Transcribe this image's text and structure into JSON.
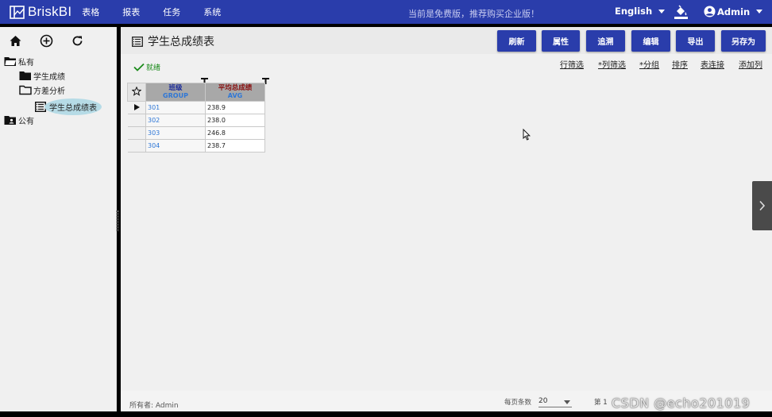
{
  "app": {
    "name": "BriskBI",
    "menu": [
      "表格",
      "报表",
      "任务",
      "系统"
    ],
    "notice": "当前是免费版，推荐购买企业版！",
    "language": "English",
    "user": "Admin"
  },
  "sidebar": {
    "tree": [
      {
        "label": "私有",
        "icon": "folder-open-icon"
      },
      {
        "label": "学生成绩",
        "icon": "folder-icon"
      },
      {
        "label": "方差分析",
        "icon": "folder-outline-icon"
      },
      {
        "label": "学生总成绩表",
        "icon": "table-icon",
        "selected": true
      },
      {
        "label": "公有",
        "icon": "folder-shared-icon"
      }
    ]
  },
  "main": {
    "title": "学生总成绩表",
    "buttons": [
      "刷新",
      "属性",
      "追溯",
      "编辑",
      "导出",
      "另存为"
    ],
    "status": "就绪",
    "links": [
      "行筛选",
      "*列筛选",
      "*分组",
      "排序",
      "表连接",
      "添加列"
    ],
    "grid": {
      "columns": [
        {
          "cn": "班级",
          "en": "GROUP"
        },
        {
          "cn": "平均总成绩",
          "en": "AVG"
        }
      ],
      "rows": [
        {
          "group": "301",
          "avg": "238.9"
        },
        {
          "group": "302",
          "avg": "238.0"
        },
        {
          "group": "303",
          "avg": "246.8"
        },
        {
          "group": "304",
          "avg": "238.7"
        }
      ]
    }
  },
  "footer": {
    "owner": "所有者: Admin",
    "perpage_label": "每页条数",
    "perpage_value": "20",
    "page_info": "第 1",
    "watermark": "CSDN @echo201019"
  },
  "colors": {
    "primary": "#2a3dab",
    "link": "#2f77d6",
    "status": "#1a8a1a"
  }
}
